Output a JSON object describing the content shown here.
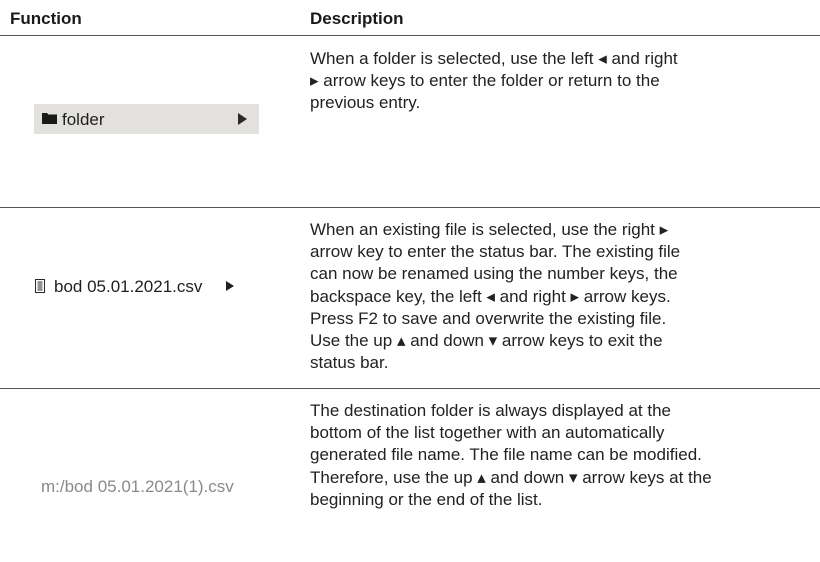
{
  "table": {
    "headers": {
      "function": "Function",
      "description": "Description"
    },
    "rows": [
      {
        "function_label": "folder",
        "function_icon": "folder-icon",
        "function_arrow_icon": "right-arrow-icon",
        "description_lines": [
          "When a folder is selected, use the left ◂ and right",
          "▸ arrow keys to enter the folder or return to the",
          "previous entry."
        ]
      },
      {
        "function_label": "bod 05.01.2021.csv",
        "function_icon": "file-icon",
        "function_arrow_icon": "right-arrow-icon",
        "description_lines": [
          "When an existing file is selected, use the right ▸",
          "arrow key to enter the status bar. The existing file",
          "can now be renamed using the number keys, the",
          "backspace key, the left ◂ and right ▸ arrow keys.",
          "Press F2 to save and overwrite the existing file.",
          "Use the up ▴ and down ▾ arrow keys to exit the",
          "status bar."
        ]
      },
      {
        "function_label": "m:/bod 05.01.2021(1).csv",
        "description_lines": [
          "The destination folder is always displayed at the",
          "bottom of the list together with an automatically",
          "generated file name. The file name can be modified.",
          "Therefore, use the up ▴ and down ▾ arrow keys at the",
          "beginning or the end of the list."
        ]
      }
    ]
  },
  "colors": {
    "folder_highlight": "#e3e1de",
    "destination_text": "#8a8a8a",
    "rule": "#555555"
  }
}
